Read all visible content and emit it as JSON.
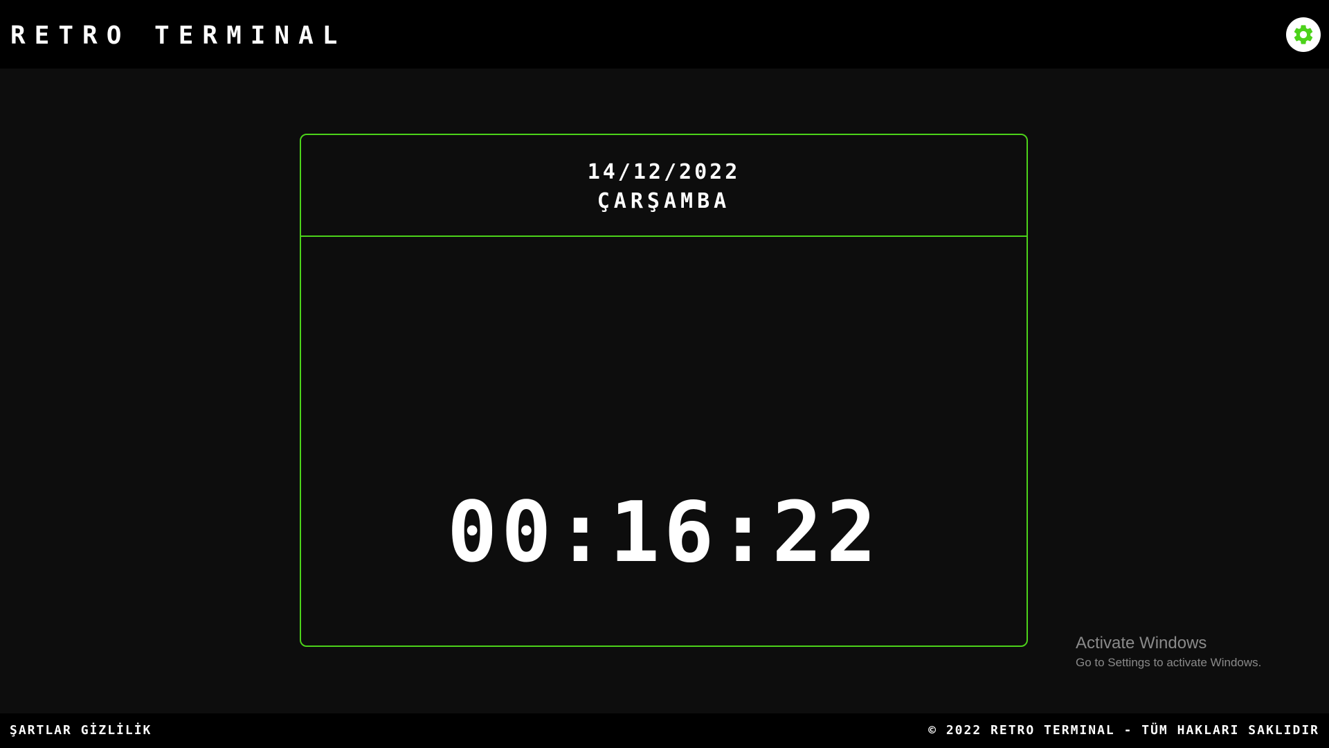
{
  "header": {
    "title": "RETRO TERMINAL",
    "settings_icon": "gear-icon",
    "settings_color": "#4cd21a"
  },
  "clock_card": {
    "date": "14/12/2022",
    "day": "ÇARŞAMBA",
    "time": "00:16:22",
    "border_color": "#4cd21a"
  },
  "watermark": {
    "title": "Activate Windows",
    "subtitle": "Go to Settings to activate Windows."
  },
  "footer": {
    "links": [
      {
        "label": "ŞARTLAR"
      },
      {
        "label": "GİZLİLİK"
      }
    ],
    "copyright": "© 2022 RETRO TERMINAL - TÜM HAKLARI SAKLIDIR"
  }
}
